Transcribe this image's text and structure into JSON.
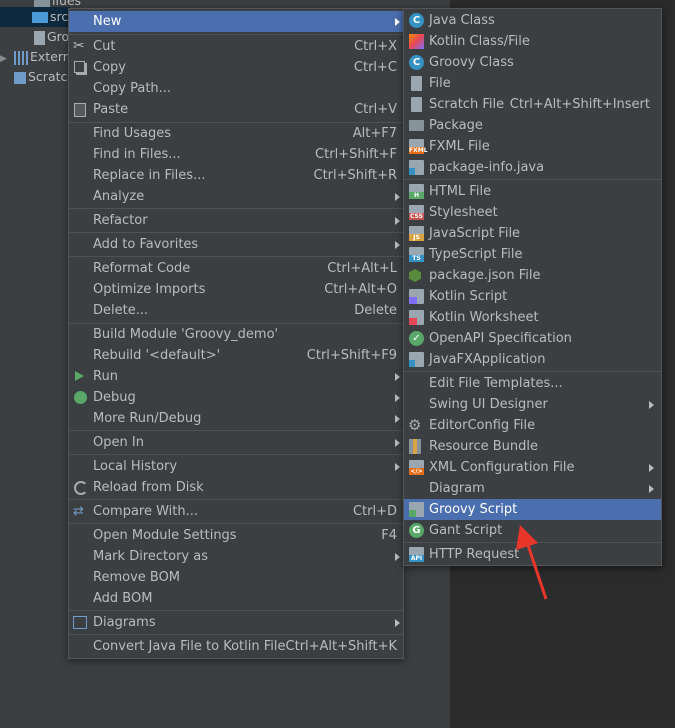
{
  "colors": {
    "accent": "#4b6eaf",
    "background": "#3c3f41",
    "text": "#bbbbbb",
    "arrow": "#e8362b"
  },
  "tree": [
    {
      "label": "ilues",
      "icon": "folder-icon"
    },
    {
      "label": "src",
      "icon": "folder-icon"
    },
    {
      "label": "Gro",
      "icon": "groovy-file-icon"
    },
    {
      "label": "Extern",
      "icon": "library-icon"
    },
    {
      "label": "Scratc",
      "icon": "scratch-icon"
    }
  ],
  "context_menu": {
    "items": [
      {
        "label": "New",
        "shortcut": ""
      },
      {
        "label": "Cut",
        "shortcut": "Ctrl+X"
      },
      {
        "label": "Copy",
        "shortcut": "Ctrl+C"
      },
      {
        "label": "Copy Path...",
        "shortcut": ""
      },
      {
        "label": "Paste",
        "shortcut": "Ctrl+V"
      },
      {
        "label": "Find Usages",
        "shortcut": "Alt+F7"
      },
      {
        "label": "Find in Files...",
        "shortcut": "Ctrl+Shift+F"
      },
      {
        "label": "Replace in Files...",
        "shortcut": "Ctrl+Shift+R"
      },
      {
        "label": "Analyze",
        "shortcut": ""
      },
      {
        "label": "Refactor",
        "shortcut": ""
      },
      {
        "label": "Add to Favorites",
        "shortcut": ""
      },
      {
        "label": "Reformat Code",
        "shortcut": "Ctrl+Alt+L"
      },
      {
        "label": "Optimize Imports",
        "shortcut": "Ctrl+Alt+O"
      },
      {
        "label": "Delete...",
        "shortcut": "Delete"
      },
      {
        "label": "Build Module 'Groovy_demo'",
        "shortcut": ""
      },
      {
        "label": "Rebuild '<default>'",
        "shortcut": "Ctrl+Shift+F9"
      },
      {
        "label": "Run",
        "shortcut": ""
      },
      {
        "label": "Debug",
        "shortcut": ""
      },
      {
        "label": "More Run/Debug",
        "shortcut": ""
      },
      {
        "label": "Open In",
        "shortcut": ""
      },
      {
        "label": "Local History",
        "shortcut": ""
      },
      {
        "label": "Reload from Disk",
        "shortcut": ""
      },
      {
        "label": "Compare With...",
        "shortcut": "Ctrl+D"
      },
      {
        "label": "Open Module Settings",
        "shortcut": "F4"
      },
      {
        "label": "Mark Directory as",
        "shortcut": ""
      },
      {
        "label": "Remove BOM",
        "shortcut": ""
      },
      {
        "label": "Add BOM",
        "shortcut": ""
      },
      {
        "label": "Diagrams",
        "shortcut": ""
      },
      {
        "label": "Convert Java File to Kotlin File",
        "shortcut": "Ctrl+Alt+Shift+K"
      }
    ]
  },
  "new_submenu": {
    "items": [
      {
        "label": "Java Class",
        "shortcut": ""
      },
      {
        "label": "Kotlin Class/File",
        "shortcut": ""
      },
      {
        "label": "Groovy Class",
        "shortcut": ""
      },
      {
        "label": "File",
        "shortcut": ""
      },
      {
        "label": "Scratch File",
        "shortcut": "Ctrl+Alt+Shift+Insert"
      },
      {
        "label": "Package",
        "shortcut": ""
      },
      {
        "label": "FXML File",
        "shortcut": ""
      },
      {
        "label": "package-info.java",
        "shortcut": ""
      },
      {
        "label": "HTML File",
        "shortcut": ""
      },
      {
        "label": "Stylesheet",
        "shortcut": ""
      },
      {
        "label": "JavaScript File",
        "shortcut": ""
      },
      {
        "label": "TypeScript File",
        "shortcut": ""
      },
      {
        "label": "package.json File",
        "shortcut": ""
      },
      {
        "label": "Kotlin Script",
        "shortcut": ""
      },
      {
        "label": "Kotlin Worksheet",
        "shortcut": ""
      },
      {
        "label": "OpenAPI Specification",
        "shortcut": ""
      },
      {
        "label": "JavaFXApplication",
        "shortcut": ""
      },
      {
        "label": "Edit File Templates...",
        "shortcut": ""
      },
      {
        "label": "Swing UI Designer",
        "shortcut": ""
      },
      {
        "label": "EditorConfig File",
        "shortcut": ""
      },
      {
        "label": "Resource Bundle",
        "shortcut": ""
      },
      {
        "label": "XML Configuration File",
        "shortcut": ""
      },
      {
        "label": "Diagram",
        "shortcut": ""
      },
      {
        "label": "Groovy Script",
        "shortcut": ""
      },
      {
        "label": "Gant Script",
        "shortcut": ""
      },
      {
        "label": "HTTP Request",
        "shortcut": ""
      }
    ],
    "icon_badges": {
      "fxml": "FXML",
      "html": "H",
      "css": "CSS",
      "js": "JS",
      "ts": "TS",
      "xml": "</>",
      "api": "API"
    }
  }
}
